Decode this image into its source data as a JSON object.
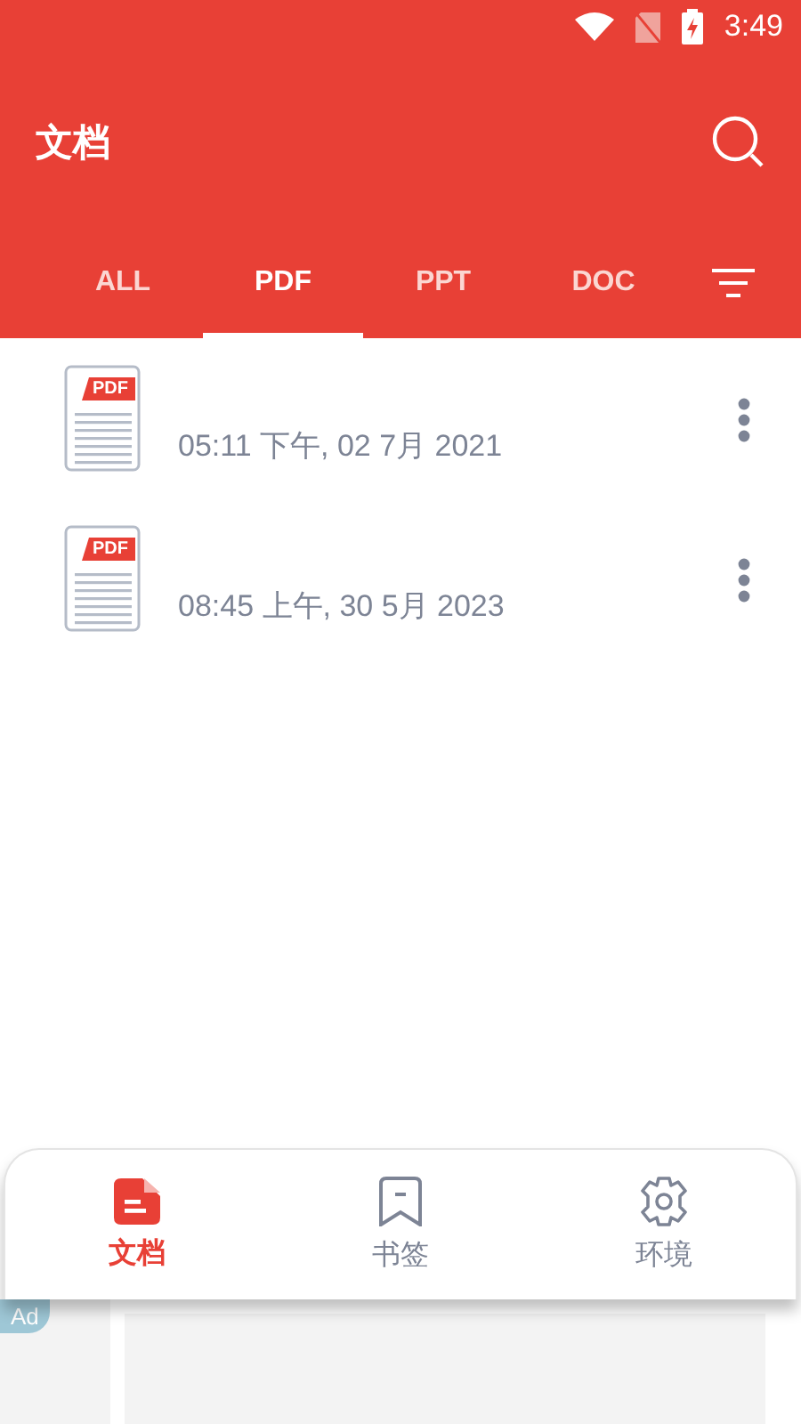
{
  "status_bar": {
    "time": "3:49"
  },
  "toolbar": {
    "title": "文档"
  },
  "tabs": [
    {
      "label": "ALL",
      "selected": false
    },
    {
      "label": "PDF",
      "selected": true
    },
    {
      "label": "PPT",
      "selected": false
    },
    {
      "label": "DOC",
      "selected": false
    }
  ],
  "files": [
    {
      "badge": "PDF",
      "date": "05:11 下午, 02 7月 2021"
    },
    {
      "badge": "PDF",
      "date": "08:45 上午, 30 5月 2023"
    }
  ],
  "bottom_nav": [
    {
      "label": "文档",
      "kind": "document",
      "selected": true
    },
    {
      "label": "书签",
      "kind": "bookmark",
      "selected": false
    },
    {
      "label": "环境",
      "kind": "settings",
      "selected": false
    }
  ],
  "ad": {
    "badge": "Ad"
  }
}
